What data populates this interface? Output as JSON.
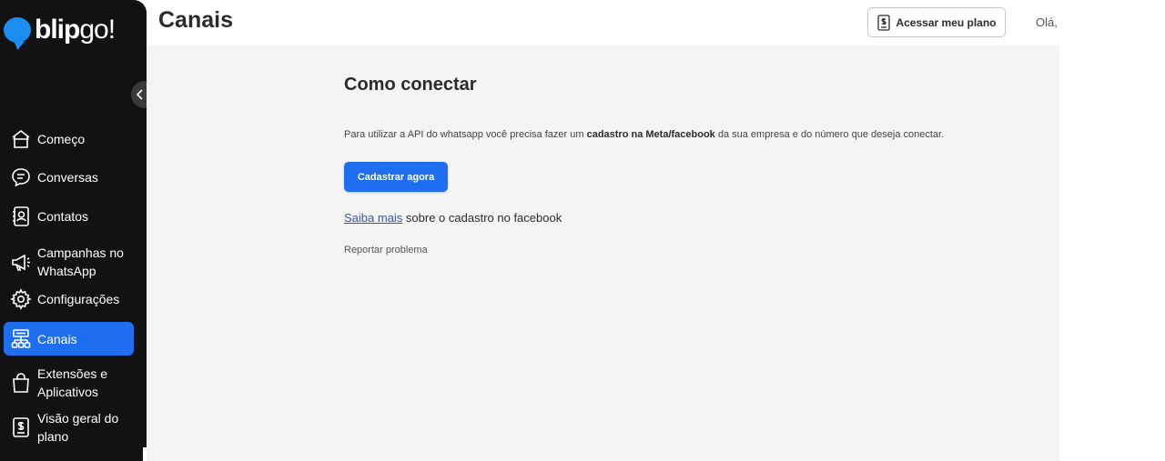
{
  "brand": {
    "logo_main": "blip",
    "logo_suffix": "go!"
  },
  "header": {
    "title": "Canais",
    "plan_button_label": "Acessar meu plano",
    "greeting": "Olá,"
  },
  "sidebar": {
    "items": [
      {
        "label": "Começo",
        "icon": "home-icon"
      },
      {
        "label": "Conversas",
        "icon": "chat-icon"
      },
      {
        "label": "Contatos",
        "icon": "contacts-icon"
      },
      {
        "label": "Campanhas no WhatsApp",
        "icon": "megaphone-icon"
      },
      {
        "label": "Configurações",
        "icon": "gear-icon"
      },
      {
        "label": "Canais",
        "icon": "channels-icon",
        "active": true
      },
      {
        "label": "Extensões e Aplicativos",
        "icon": "bag-icon"
      },
      {
        "label": "Visão geral do plano",
        "icon": "plan-icon"
      }
    ]
  },
  "main": {
    "heading": "Como conectar",
    "description_pre": "Para utilizar a API do whatsapp você precisa fazer um ",
    "description_bold": "cadastro na Meta/facebook",
    "description_post": " da sua empresa e do número que deseja conectar.",
    "register_button": "Cadastrar agora",
    "learn_more_link": "Saiba mais",
    "learn_more_rest": " sobre o cadastro no facebook",
    "report_link": "Reportar problema"
  },
  "colors": {
    "sidebar_bg": "#121212",
    "accent": "#1f6ef0",
    "main_bg": "#f4f4f4"
  }
}
